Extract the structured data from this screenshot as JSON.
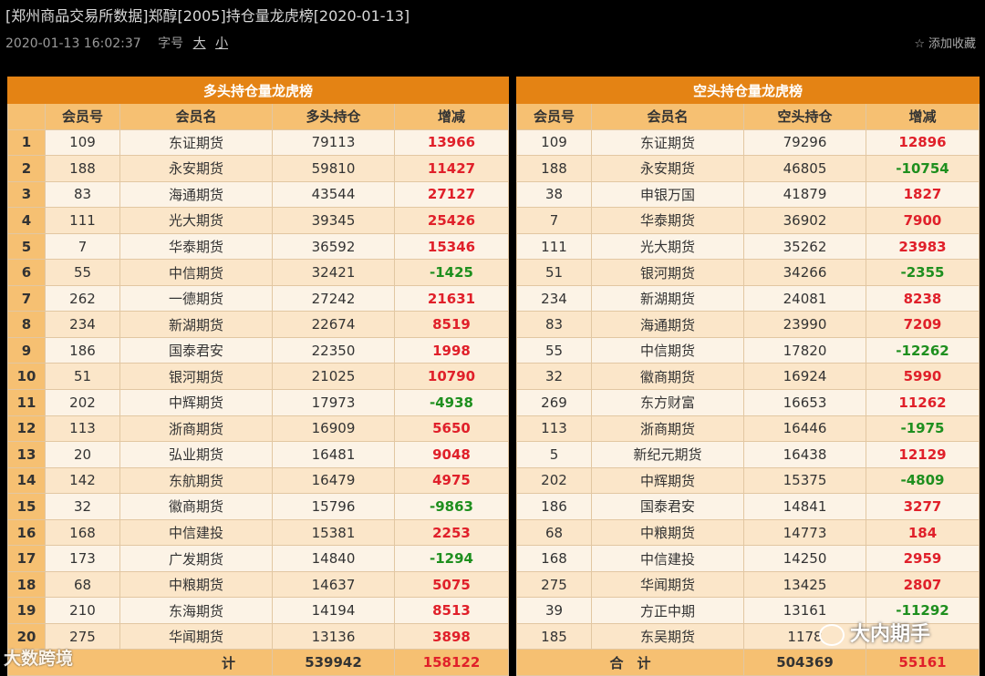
{
  "header": {
    "title": "[郑州商品交易所数据]郑醇[2005]持仓量龙虎榜[2020-01-13]",
    "timestamp": "2020-01-13 16:02:37",
    "font_label": "字号",
    "font_large": "大",
    "font_small": "小",
    "favorite_label": "添加收藏",
    "favorite_icon": "star-outline-icon"
  },
  "long_table": {
    "caption": "多头持仓量龙虎榜",
    "headers": [
      "",
      "会员号",
      "会员名",
      "多头持仓",
      "增减"
    ],
    "rows": [
      {
        "rank": "1",
        "member_id": "109",
        "name": "东证期货",
        "position": "79113",
        "change": "13966"
      },
      {
        "rank": "2",
        "member_id": "188",
        "name": "永安期货",
        "position": "59810",
        "change": "11427"
      },
      {
        "rank": "3",
        "member_id": "83",
        "name": "海通期货",
        "position": "43544",
        "change": "27127"
      },
      {
        "rank": "4",
        "member_id": "111",
        "name": "光大期货",
        "position": "39345",
        "change": "25426"
      },
      {
        "rank": "5",
        "member_id": "7",
        "name": "华泰期货",
        "position": "36592",
        "change": "15346"
      },
      {
        "rank": "6",
        "member_id": "55",
        "name": "中信期货",
        "position": "32421",
        "change": "-1425"
      },
      {
        "rank": "7",
        "member_id": "262",
        "name": "一德期货",
        "position": "27242",
        "change": "21631"
      },
      {
        "rank": "8",
        "member_id": "234",
        "name": "新湖期货",
        "position": "22674",
        "change": "8519"
      },
      {
        "rank": "9",
        "member_id": "186",
        "name": "国泰君安",
        "position": "22350",
        "change": "1998"
      },
      {
        "rank": "10",
        "member_id": "51",
        "name": "银河期货",
        "position": "21025",
        "change": "10790"
      },
      {
        "rank": "11",
        "member_id": "202",
        "name": "中辉期货",
        "position": "17973",
        "change": "-4938"
      },
      {
        "rank": "12",
        "member_id": "113",
        "name": "浙商期货",
        "position": "16909",
        "change": "5650"
      },
      {
        "rank": "13",
        "member_id": "20",
        "name": "弘业期货",
        "position": "16481",
        "change": "9048"
      },
      {
        "rank": "14",
        "member_id": "142",
        "name": "东航期货",
        "position": "16479",
        "change": "4975"
      },
      {
        "rank": "15",
        "member_id": "32",
        "name": "徽商期货",
        "position": "15796",
        "change": "-9863"
      },
      {
        "rank": "16",
        "member_id": "168",
        "name": "中信建投",
        "position": "15381",
        "change": "2253"
      },
      {
        "rank": "17",
        "member_id": "173",
        "name": "广发期货",
        "position": "14840",
        "change": "-1294"
      },
      {
        "rank": "18",
        "member_id": "68",
        "name": "中粮期货",
        "position": "14637",
        "change": "5075"
      },
      {
        "rank": "19",
        "member_id": "210",
        "name": "东海期货",
        "position": "14194",
        "change": "8513"
      },
      {
        "rank": "20",
        "member_id": "275",
        "name": "华闻期货",
        "position": "13136",
        "change": "3898"
      }
    ],
    "total": {
      "label": "计",
      "position": "539942",
      "change": "158122"
    }
  },
  "short_table": {
    "caption": "空头持仓量龙虎榜",
    "headers": [
      "会员号",
      "会员名",
      "空头持仓",
      "增减"
    ],
    "rows": [
      {
        "member_id": "109",
        "name": "东证期货",
        "position": "79296",
        "change": "12896"
      },
      {
        "member_id": "188",
        "name": "永安期货",
        "position": "46805",
        "change": "-10754"
      },
      {
        "member_id": "38",
        "name": "申银万国",
        "position": "41879",
        "change": "1827"
      },
      {
        "member_id": "7",
        "name": "华泰期货",
        "position": "36902",
        "change": "7900"
      },
      {
        "member_id": "111",
        "name": "光大期货",
        "position": "35262",
        "change": "23983"
      },
      {
        "member_id": "51",
        "name": "银河期货",
        "position": "34266",
        "change": "-2355"
      },
      {
        "member_id": "234",
        "name": "新湖期货",
        "position": "24081",
        "change": "8238"
      },
      {
        "member_id": "83",
        "name": "海通期货",
        "position": "23990",
        "change": "7209"
      },
      {
        "member_id": "55",
        "name": "中信期货",
        "position": "17820",
        "change": "-12262"
      },
      {
        "member_id": "32",
        "name": "徽商期货",
        "position": "16924",
        "change": "5990"
      },
      {
        "member_id": "269",
        "name": "东方财富",
        "position": "16653",
        "change": "11262"
      },
      {
        "member_id": "113",
        "name": "浙商期货",
        "position": "16446",
        "change": "-1975"
      },
      {
        "member_id": "5",
        "name": "新纪元期货",
        "position": "16438",
        "change": "12129"
      },
      {
        "member_id": "202",
        "name": "中辉期货",
        "position": "15375",
        "change": "-4809"
      },
      {
        "member_id": "186",
        "name": "国泰君安",
        "position": "14841",
        "change": "3277"
      },
      {
        "member_id": "68",
        "name": "中粮期货",
        "position": "14773",
        "change": "184"
      },
      {
        "member_id": "168",
        "name": "中信建投",
        "position": "14250",
        "change": "2959"
      },
      {
        "member_id": "275",
        "name": "华闻期货",
        "position": "13425",
        "change": "2807"
      },
      {
        "member_id": "39",
        "name": "方正中期",
        "position": "13161",
        "change": "-11292"
      },
      {
        "member_id": "185",
        "name": "东吴期货",
        "position": "1178",
        "change": ""
      }
    ],
    "total": {
      "label": "合　计",
      "position": "504369",
      "change": "55161"
    }
  },
  "watermarks": {
    "left": "大数跨境",
    "right": "大内期手"
  },
  "colors": {
    "caption_bg": "#e48314",
    "header_bg": "#f6c072",
    "row_alt_bg": "#fbe6c9",
    "row_bg": "#fcf3e6",
    "positive": "#e0202a",
    "negative": "#1e8f1e"
  }
}
